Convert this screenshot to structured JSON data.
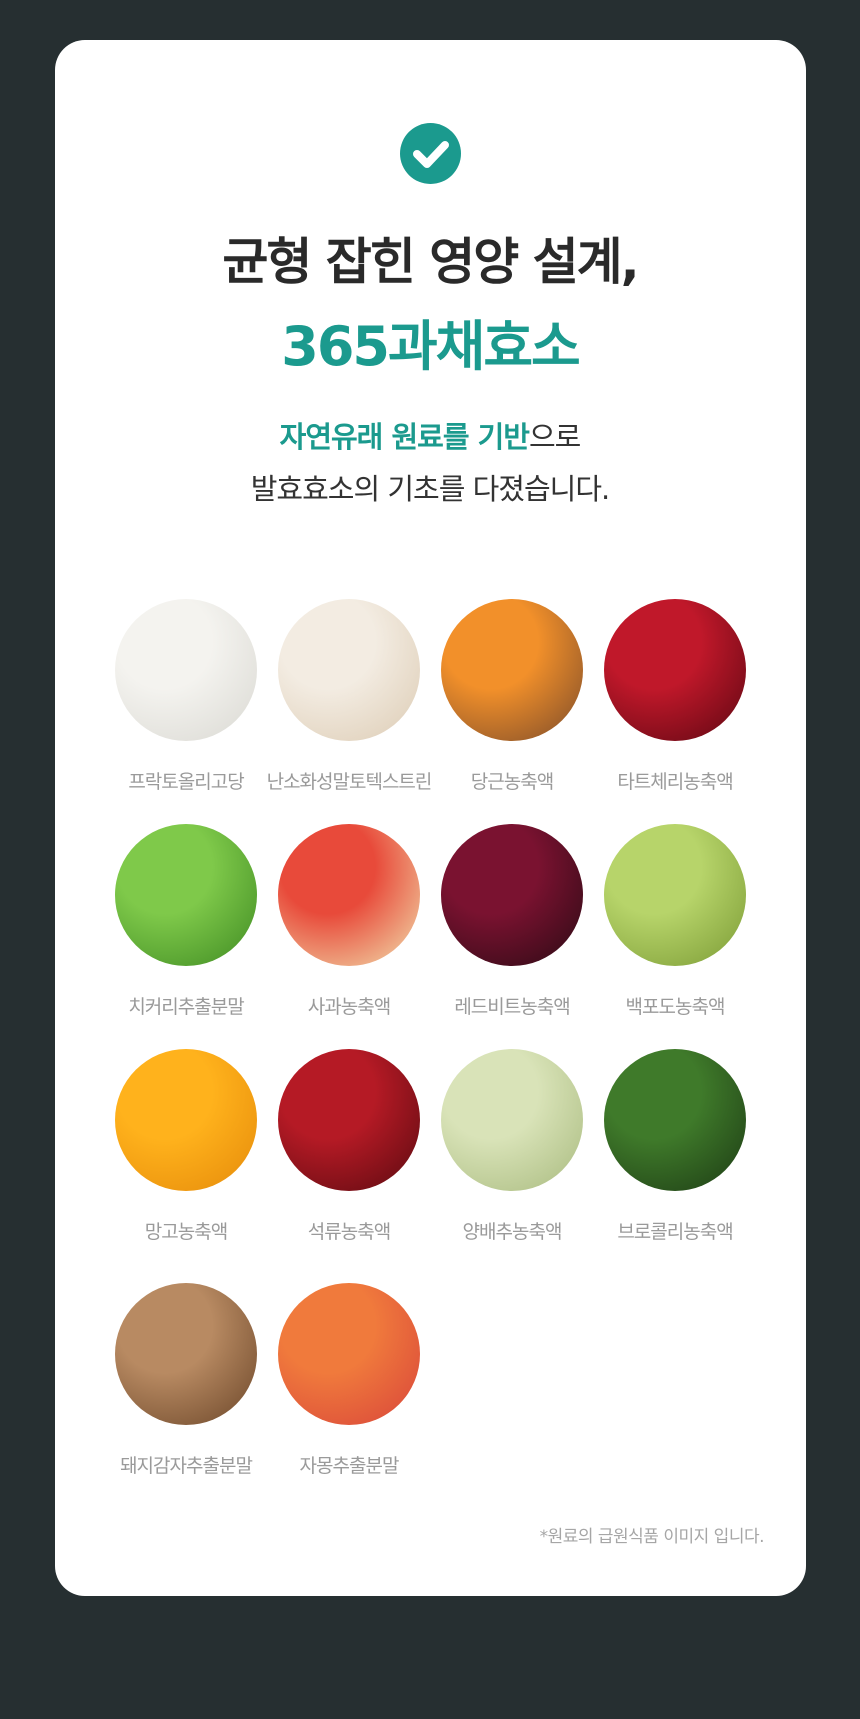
{
  "heading": {
    "line1": "균형 잡힌 영양 설계,",
    "line2": "365과채효소"
  },
  "subtitle": {
    "line1_highlight": "자연유래 원료를 기반",
    "line1_rest": "으로",
    "line2": "발효효소의 기초를 다졌습니다."
  },
  "ingredients": [
    {
      "label": "프락토올리고당",
      "icon": "white-powder-bowl",
      "colors": [
        "#f4f3ef",
        "#d9d8d2"
      ]
    },
    {
      "label": "난소화성말토텍스트린",
      "icon": "cream-powder-scoop",
      "colors": [
        "#f3ece2",
        "#dccbb3"
      ]
    },
    {
      "label": "당근농축액",
      "icon": "carrot-juice",
      "colors": [
        "#f2902a",
        "#7a4a2a"
      ]
    },
    {
      "label": "타트체리농축액",
      "icon": "tart-cherries",
      "colors": [
        "#c0182a",
        "#5c0712"
      ]
    },
    {
      "label": "치커리추출분말",
      "icon": "chicory-leaves",
      "colors": [
        "#7fc94a",
        "#3e8a22"
      ]
    },
    {
      "label": "사과농축액",
      "icon": "apples-juice",
      "colors": [
        "#e84a3a",
        "#f1e3b0"
      ]
    },
    {
      "label": "레드비트농축액",
      "icon": "red-beet-juice",
      "colors": [
        "#7a1230",
        "#2a0a14"
      ]
    },
    {
      "label": "백포도농축액",
      "icon": "green-grapes",
      "colors": [
        "#b7d46a",
        "#7a9a34"
      ]
    },
    {
      "label": "망고농축액",
      "icon": "mango-cubes",
      "colors": [
        "#ffb21c",
        "#e58a0a"
      ]
    },
    {
      "label": "석류농축액",
      "icon": "pomegranate",
      "colors": [
        "#b51a25",
        "#5a0a10"
      ]
    },
    {
      "label": "양배추농축액",
      "icon": "cabbage-juice",
      "colors": [
        "#d9e3b8",
        "#a8ba7e"
      ]
    },
    {
      "label": "브로콜리농축액",
      "icon": "broccoli",
      "colors": [
        "#3f7a2a",
        "#1c3a14"
      ]
    },
    {
      "label": "돼지감자추출분말",
      "icon": "jerusalem-artichoke",
      "colors": [
        "#b88a62",
        "#6a4528"
      ]
    },
    {
      "label": "자몽추출분말",
      "icon": "grapefruit",
      "colors": [
        "#f07a3c",
        "#d8443a"
      ]
    }
  ],
  "note": "*원료의 급원식품 이미지 입니다.",
  "colors": {
    "accent": "#1b9a8e",
    "background": "#262f31",
    "card": "#ffffff"
  }
}
